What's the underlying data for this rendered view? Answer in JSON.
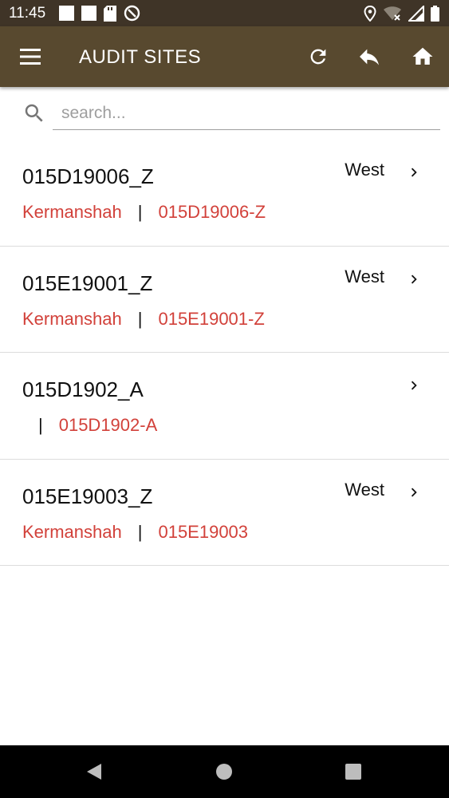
{
  "status_bar": {
    "time": "11:45",
    "left_icons": [
      "notification-square-icon",
      "notification-square-icon",
      "sd-card-icon",
      "data-saver-icon"
    ],
    "right_icons": [
      "location-icon",
      "wifi-icon",
      "signal-icon",
      "battery-icon"
    ]
  },
  "app_bar": {
    "title": "AUDIT SITES",
    "background": "#58492f",
    "icons": [
      "menu-icon",
      "refresh-icon",
      "reply-icon",
      "home-icon"
    ]
  },
  "search": {
    "placeholder": "search...",
    "value": ""
  },
  "sites": [
    {
      "name": "015D19006_Z",
      "city": "Kermanshah",
      "separator": "|",
      "code": "015D19006-Z",
      "region": "West"
    },
    {
      "name": "015E19001_Z",
      "city": "Kermanshah",
      "separator": "|",
      "code": "015E19001-Z",
      "region": "West"
    },
    {
      "name": "015D1902_A",
      "city": "",
      "separator": "|",
      "code": "015D1902-A",
      "region": ""
    },
    {
      "name": "015E19003_Z",
      "city": "Kermanshah",
      "separator": "|",
      "code": "015E19003",
      "region": "West"
    }
  ],
  "colors": {
    "accent_red": "#d2413a",
    "status_bar": "#3f3427"
  },
  "nav_bar": {
    "buttons": [
      "back-icon",
      "home-circle-icon",
      "recents-icon"
    ]
  }
}
